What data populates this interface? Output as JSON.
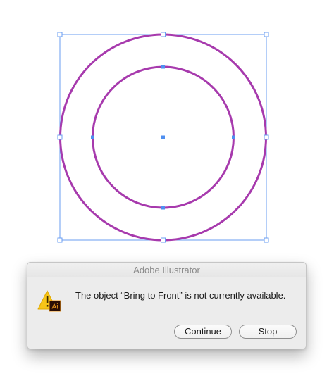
{
  "canvas": {
    "stroke_color": "#a73aad",
    "selection_color": "#4f8ff0"
  },
  "dialog": {
    "title": "Adobe Illustrator",
    "message": "The object “Bring to Front” is not currently available.",
    "icon": "warning-icon",
    "app_badge": "Ai",
    "buttons": {
      "continue_label": "Continue",
      "stop_label": "Stop"
    }
  }
}
